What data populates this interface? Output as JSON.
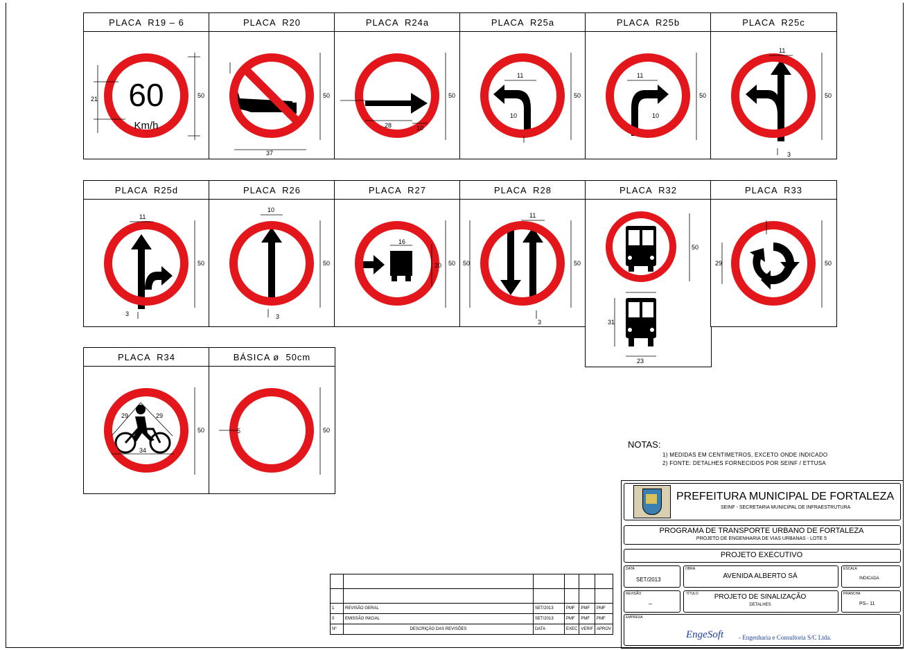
{
  "signs": [
    {
      "label": "PLACA  R19 – 6"
    },
    {
      "label": "PLACA  R20"
    },
    {
      "label": "PLACA  R24a"
    },
    {
      "label": "PLACA  R25a"
    },
    {
      "label": "PLACA  R25b"
    },
    {
      "label": "PLACA  R25c"
    },
    {
      "label": "PLACA  R25d"
    },
    {
      "label": "PLACA  R26"
    },
    {
      "label": "PLACA  R27"
    },
    {
      "label": "PLACA  R28"
    },
    {
      "label": "PLACA  R32"
    },
    {
      "label": "PLACA  R33"
    },
    {
      "label": "PLACA  R34"
    },
    {
      "label": "BÁSICA ø  50cm"
    }
  ],
  "sign_text": {
    "speed": "60",
    "unit": "Km/h"
  },
  "colors": {
    "ring": "#e3161b",
    "symbol": "#000000"
  },
  "notes": {
    "title": "NOTAS:",
    "items": [
      "1) MEDIDAS EM CENTIMETROS, EXCETO ONDE INDICADO",
      "2) FONTE: DETALHES FORNECIDOS POR SEINF / ETTUSA"
    ]
  },
  "title_block": {
    "org": "PREFEITURA MUNICIPAL DE FORTALEZA",
    "org_sub": "SEINF - SECRETARIA MUNICIPAL DE INFRAESTRUTURA",
    "program": "PROGRAMA DE TRANSPORTE URBANO DE FORTALEZA",
    "program_sub": "PROJETO DE ENGENHARIA DE VIAS URBANAS - LOTE 5",
    "phase": "PROJETO EXECUTIVO",
    "date_label": "DATA",
    "date": "SET/2013",
    "work_label": "OBRA",
    "work": "AVENIDA ALBERTO SÁ",
    "scale_label": "ESCALA",
    "scale": "INDICADA",
    "rev_label": "REVISÃO",
    "rev": "–",
    "title_label": "TÍTULO",
    "title": "PROJETO DE SINALIZAÇÃO",
    "title_sub": "DETALHES",
    "sheet_label": "PRANCHA",
    "sheet": "PS– 11",
    "company_label": "EMPRESA",
    "company_logo": "EngeSoft",
    "company": "- Engenharia e Consultoria S/C Ltda."
  },
  "revisions": {
    "rows": [
      {
        "n": "1",
        "desc": "REVISÃO GERAL",
        "date": "SET/2013",
        "a": "PMF",
        "b": "PMF",
        "c": "PMF"
      },
      {
        "n": "0",
        "desc": "EMISSÃO INICIAL",
        "date": "SET/2013",
        "a": "PMF",
        "b": "PMF",
        "c": "PMF"
      }
    ],
    "header": {
      "n": "Nº",
      "desc": "DESCRIÇÃO DAS REVISÕES",
      "date": "DATA",
      "a": "EXEC",
      "b": "VERIF",
      "c": "APROV"
    }
  }
}
